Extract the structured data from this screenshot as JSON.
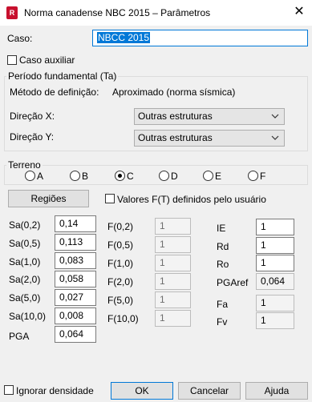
{
  "window": {
    "title": "Norma canadense NBC 2015 – Parâmetros",
    "app_icon_text": "R"
  },
  "caso": {
    "label": "Caso:",
    "value": "NBCC 2015"
  },
  "caso_auxiliar": {
    "label": "Caso auxiliar",
    "checked": false
  },
  "periodo": {
    "title": "Período fundamental (Ta)",
    "metodo_label": "Método de definição:",
    "metodo_value": "Aproximado (norma sísmica)",
    "direcao_x_label": "Direção X:",
    "direcao_x_value": "Outras estruturas",
    "direcao_y_label": "Direção Y:",
    "direcao_y_value": "Outras estruturas"
  },
  "terreno": {
    "title": "Terreno",
    "options": [
      "A",
      "B",
      "C",
      "D",
      "E",
      "F"
    ],
    "selected": "C"
  },
  "regioes_button": "Regiões",
  "valores_ft": {
    "label": "Valores F(T) definidos pelo usuário",
    "checked": false
  },
  "sa": {
    "labels": [
      "Sa(0,2)",
      "Sa(0,5)",
      "Sa(1,0)",
      "Sa(2,0)",
      "Sa(5,0)",
      "Sa(10,0)",
      "PGA"
    ],
    "values": [
      "0,14",
      "0,113",
      "0,083",
      "0,058",
      "0,027",
      "0,008",
      "0,064"
    ]
  },
  "f": {
    "labels": [
      "F(0,2)",
      "F(0,5)",
      "F(1,0)",
      "F(2,0)",
      "F(5,0)",
      "F(10,0)"
    ],
    "values": [
      "1",
      "1",
      "1",
      "1",
      "1",
      "1"
    ]
  },
  "right": {
    "ie_label": "IE",
    "ie_value": "1",
    "rd_label": "Rd",
    "rd_value": "1",
    "ro_label": "Ro",
    "ro_value": "1",
    "pgaref_label": "PGAref",
    "pgaref_value": "0,064",
    "fa_label": "Fa",
    "fa_value": "1",
    "fv_label": "Fv",
    "fv_value": "1"
  },
  "ignorar_densidade": {
    "label": "Ignorar densidade",
    "checked": false
  },
  "buttons": {
    "ok": "OK",
    "cancelar": "Cancelar",
    "ajuda": "Ajuda"
  },
  "icons": {
    "close": "close-icon",
    "chevron": "chevron-down-icon"
  },
  "colors": {
    "accent": "#0078d7",
    "app_icon": "#c8102e"
  }
}
